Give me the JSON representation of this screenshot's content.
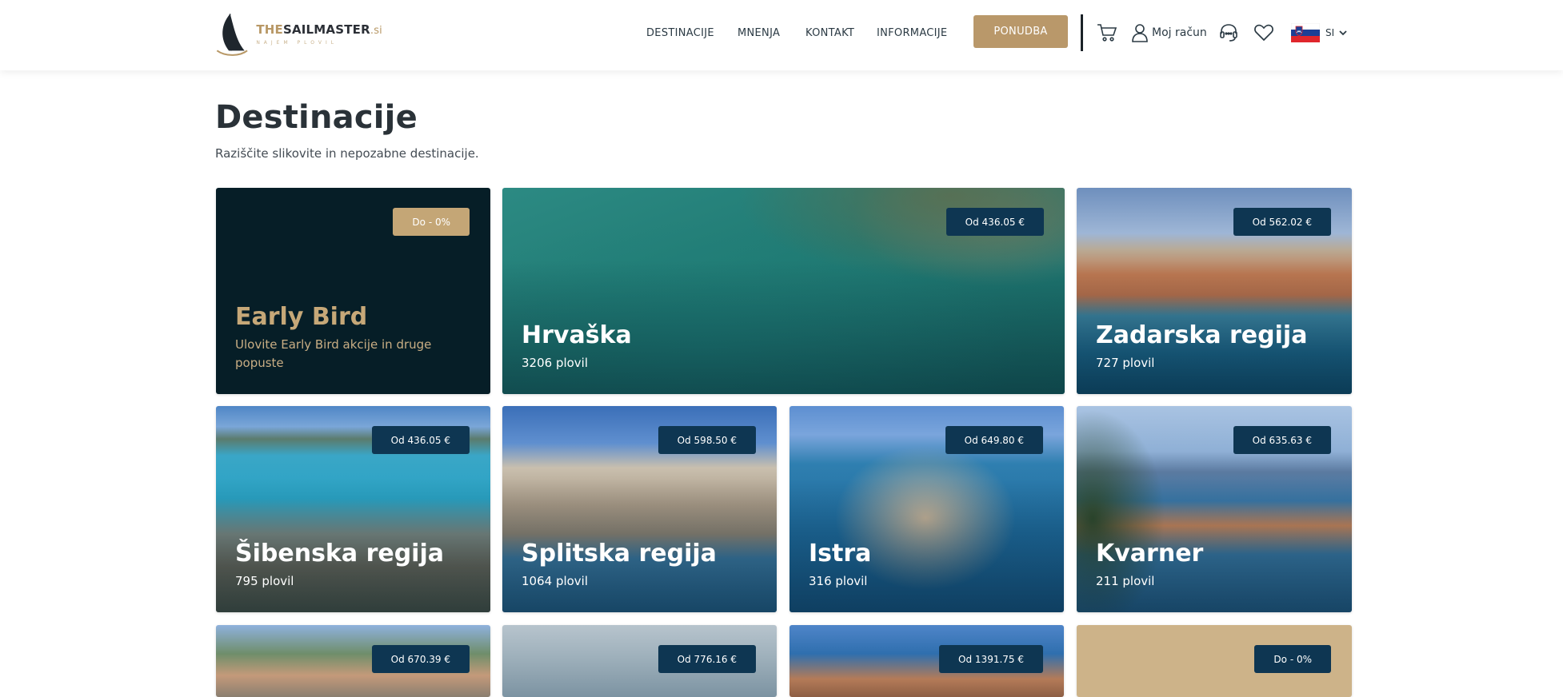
{
  "header": {
    "logo": {
      "prefix": "THE",
      "name": "SAILMASTER",
      "tld": ".si",
      "tagline": "NAJEM PLOVIL"
    },
    "nav": [
      "DESTINACIJE",
      "MNENJA",
      "KONTAKT",
      "INFORMACIJE"
    ],
    "cta_label": "PONUDBA",
    "account_label": "Moj račun",
    "language": "SI",
    "icons": [
      "cart-icon",
      "user-icon",
      "support-icon",
      "heart-icon",
      "slovenia-flag-icon",
      "chevron-down-icon"
    ]
  },
  "page": {
    "title": "Destinacije",
    "subtitle": "Raziščite slikovite in nepozabne destinacije."
  },
  "cards": [
    {
      "title": "Early Bird",
      "subtitle": "Ulovite Early Bird akcije in druge popuste",
      "badge": "Do - 0%"
    },
    {
      "title": "Hrvaška",
      "subtitle": "3206 plovil",
      "badge": "Od 436.05 €"
    },
    {
      "title": "Zadarska regija",
      "subtitle": "727 plovil",
      "badge": "Od 562.02 €"
    },
    {
      "title": "Šibenska regija",
      "subtitle": "795 plovil",
      "badge": "Od 436.05 €"
    },
    {
      "title": "Splitska regija",
      "subtitle": "1064 plovil",
      "badge": "Od 598.50 €"
    },
    {
      "title": "Istra",
      "subtitle": "316 plovil",
      "badge": "Od 649.80 €"
    },
    {
      "title": "Kvarner",
      "subtitle": "211 plovil",
      "badge": "Od 635.63 €"
    },
    {
      "badge": "Od 670.39 €"
    },
    {
      "badge": "Od 776.16 €"
    },
    {
      "badge": "Od 1391.75 €"
    },
    {
      "badge": "Do - 0%"
    }
  ],
  "colors": {
    "accent_gold": "#b9986a",
    "badge_navy": "#0e3652",
    "early_bird_bg": "#061e27"
  }
}
